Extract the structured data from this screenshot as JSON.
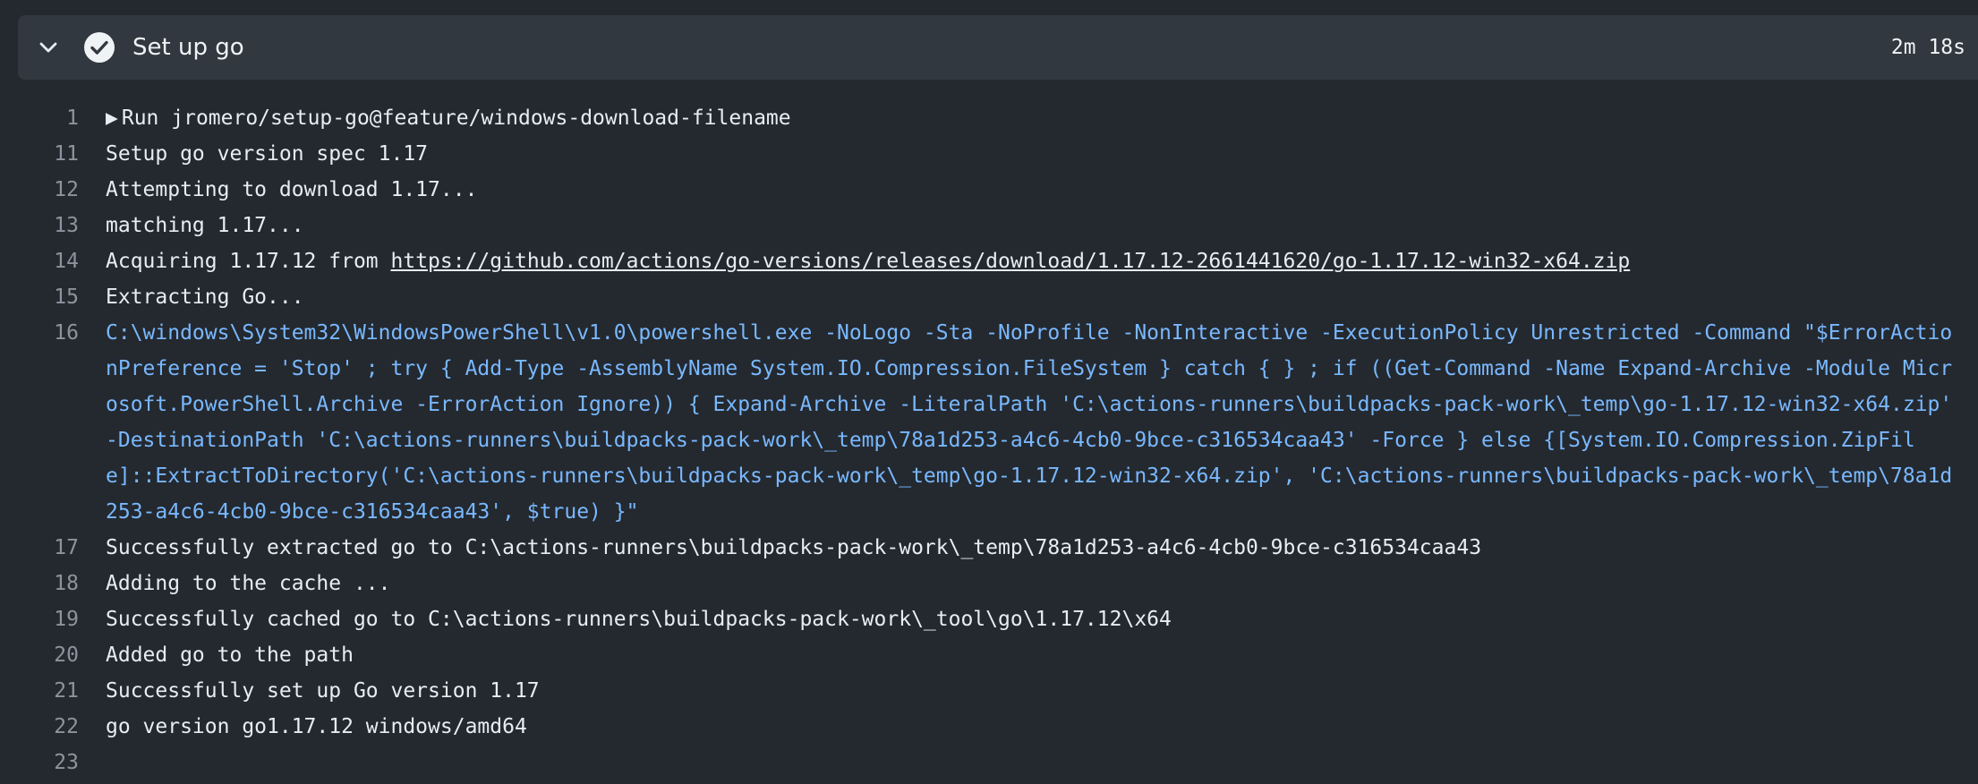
{
  "step": {
    "title": "Set up go",
    "duration": "2m 18s",
    "expanded_icon": "chevron-down-icon",
    "status_icon": "check-circle-icon",
    "status_color": "#f0f3f6"
  },
  "log": {
    "line_number_color": "#8b949e",
    "command_color": "#79b8ff",
    "lines": [
      {
        "n": "1",
        "text": "Run jromero/setup-go@feature/windows-download-filename"
      },
      {
        "n": "11",
        "text": "Setup go version spec 1.17"
      },
      {
        "n": "12",
        "text": "Attempting to download 1.17..."
      },
      {
        "n": "13",
        "text": "matching 1.17..."
      },
      {
        "n": "14",
        "prefix": "Acquiring 1.17.12 from ",
        "link": "https://github.com/actions/go-versions/releases/download/1.17.12-2661441620/go-1.17.12-win32-x64.zip"
      },
      {
        "n": "15",
        "text": "Extracting Go..."
      },
      {
        "n": "16",
        "text": "C:\\windows\\System32\\WindowsPowerShell\\v1.0\\powershell.exe -NoLogo -Sta -NoProfile -NonInteractive -ExecutionPolicy Unrestricted -Command \"$ErrorActionPreference = 'Stop' ; try { Add-Type -AssemblyName System.IO.Compression.FileSystem } catch { } ; if ((Get-Command -Name Expand-Archive -Module Microsoft.PowerShell.Archive -ErrorAction Ignore)) { Expand-Archive -LiteralPath 'C:\\actions-runners\\buildpacks-pack-work\\_temp\\go-1.17.12-win32-x64.zip' -DestinationPath 'C:\\actions-runners\\buildpacks-pack-work\\_temp\\78a1d253-a4c6-4cb0-9bce-c316534caa43' -Force } else {[System.IO.Compression.ZipFile]::ExtractToDirectory('C:\\actions-runners\\buildpacks-pack-work\\_temp\\go-1.17.12-win32-x64.zip', 'C:\\actions-runners\\buildpacks-pack-work\\_temp\\78a1d253-a4c6-4cb0-9bce-c316534caa43', $true) }\""
      },
      {
        "n": "17",
        "text": "Successfully extracted go to C:\\actions-runners\\buildpacks-pack-work\\_temp\\78a1d253-a4c6-4cb0-9bce-c316534caa43"
      },
      {
        "n": "18",
        "text": "Adding to the cache ..."
      },
      {
        "n": "19",
        "text": "Successfully cached go to C:\\actions-runners\\buildpacks-pack-work\\_tool\\go\\1.17.12\\x64"
      },
      {
        "n": "20",
        "text": "Added go to the path"
      },
      {
        "n": "21",
        "text": "Successfully set up Go version 1.17"
      },
      {
        "n": "22",
        "text": "go version go1.17.12 windows/amd64"
      },
      {
        "n": "23",
        "text": ""
      }
    ]
  }
}
